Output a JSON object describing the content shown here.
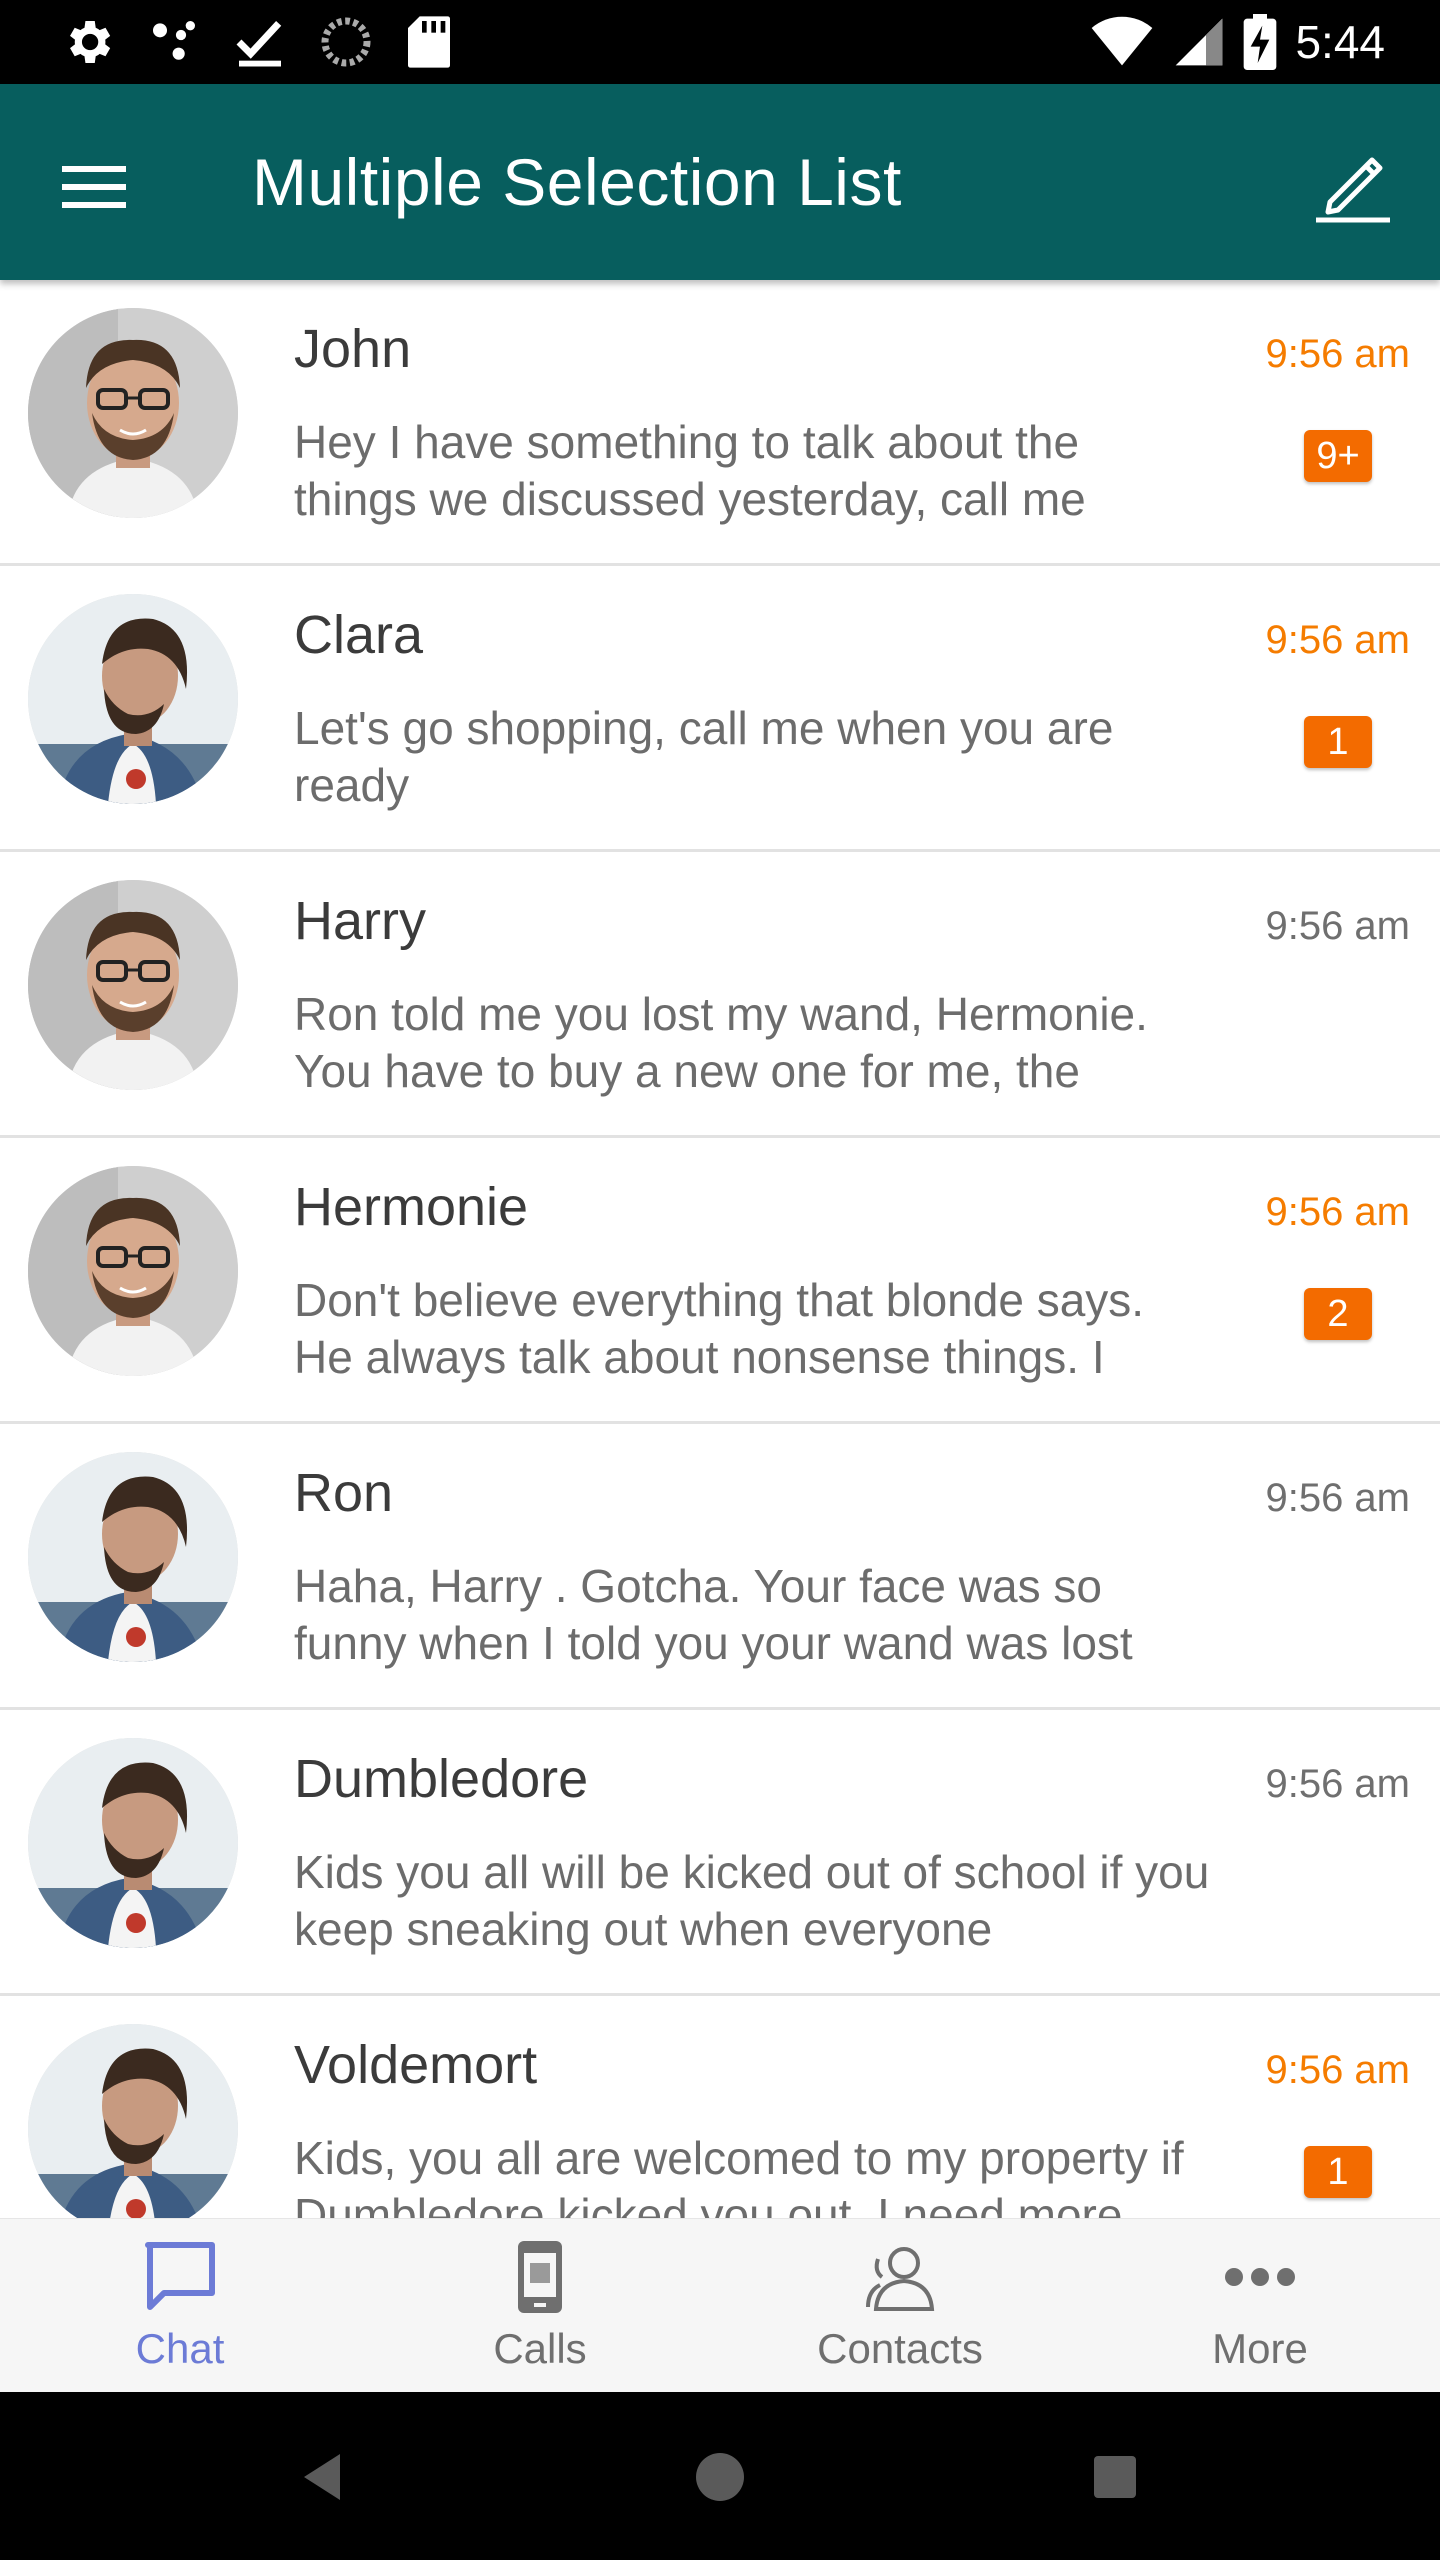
{
  "status_bar": {
    "time": "5:44",
    "left_icons": [
      "settings-icon",
      "hub-icon",
      "check-icon",
      "sync-icon",
      "sd-card-icon"
    ],
    "right_icons": [
      "wifi-icon",
      "cell-signal-icon",
      "battery-charging-icon"
    ]
  },
  "app_bar": {
    "title": "Multiple Selection List",
    "menu_icon": "menu-icon",
    "action_icon": "edit-icon"
  },
  "colors": {
    "app_bar": "#075e5e",
    "accent": "#f57c00",
    "badge": "#f36b00",
    "nav_active": "#6c7bd6"
  },
  "conversations": [
    {
      "name": "John",
      "time": "9:56 am",
      "unread": true,
      "badge": "9+",
      "avatar": "avatar-glasses",
      "message": "Hey I have something to talk about the things we discussed yesterday, call me"
    },
    {
      "name": "Clara",
      "time": "9:56 am",
      "unread": true,
      "badge": "1",
      "avatar": "avatar-beard",
      "message": "Let's go shopping, call me when you are ready"
    },
    {
      "name": "Harry",
      "time": "9:56 am",
      "unread": false,
      "badge": "",
      "avatar": "avatar-glasses",
      "message": "Ron told me you lost my wand, Hermonie. You have to buy a new one for me, the"
    },
    {
      "name": "Hermonie",
      "time": "9:56 am",
      "unread": true,
      "badge": "2",
      "avatar": "avatar-glasses",
      "message": "Don't believe everything that blonde says. He always talk about nonsense things. I"
    },
    {
      "name": "Ron",
      "time": "9:56 am",
      "unread": false,
      "badge": "",
      "avatar": "avatar-beard",
      "message": "Haha, Harry . Gotcha. Your face was so funny when I told you your wand was lost"
    },
    {
      "name": "Dumbledore",
      "time": "9:56 am",
      "unread": false,
      "badge": "",
      "avatar": "avatar-beard",
      "message": "Kids you all will be kicked out of school if you keep sneaking out when everyone"
    },
    {
      "name": "Voldemort",
      "time": "9:56 am",
      "unread": true,
      "badge": "1",
      "avatar": "avatar-beard",
      "message": "Kids, you all are welcomed to my property if Dumbledore kicked you out. I need more"
    }
  ],
  "bottom_nav": [
    {
      "label": "Chat",
      "icon": "chat-icon",
      "active": true
    },
    {
      "label": "Calls",
      "icon": "phone-icon",
      "active": false
    },
    {
      "label": "Contacts",
      "icon": "contacts-icon",
      "active": false
    },
    {
      "label": "More",
      "icon": "more-icon",
      "active": false
    }
  ],
  "system_nav": [
    "back-icon",
    "home-icon",
    "recents-icon"
  ]
}
